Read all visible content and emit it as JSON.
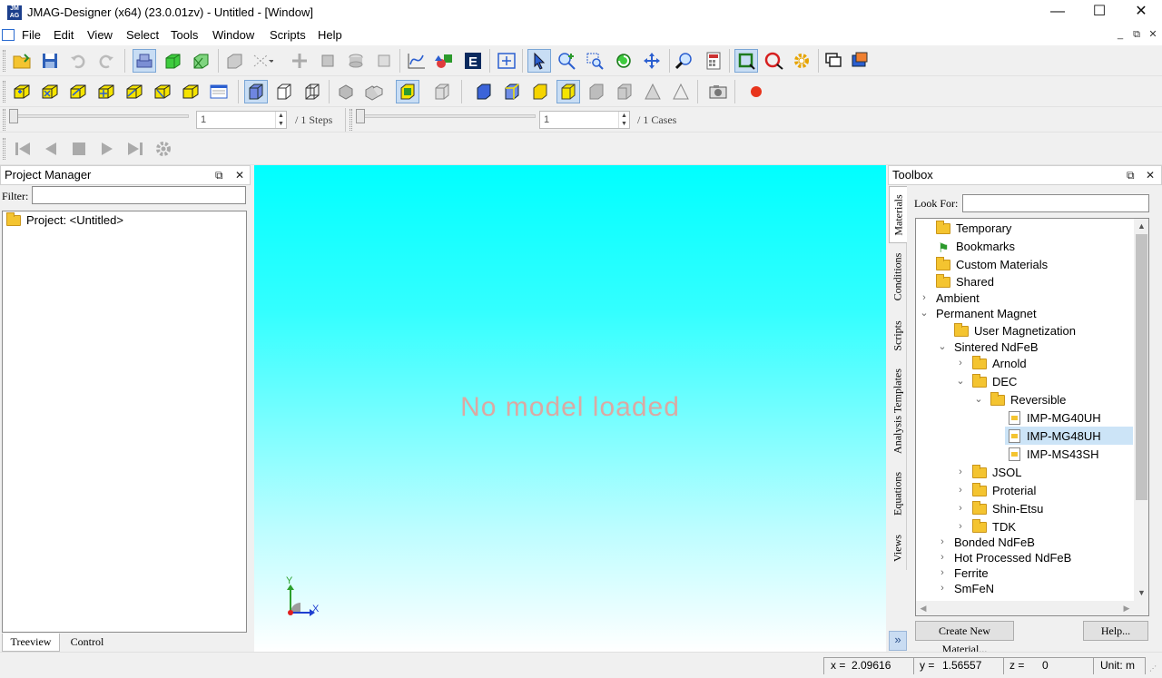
{
  "window": {
    "title": "JMAG-Designer (x64) (23.0.01zv) - Untitled - [Window]",
    "app_icon_text": "JM AG",
    "minimize": "—",
    "maximize": "☐",
    "close": "✕"
  },
  "menu": {
    "items": [
      "File",
      "Edit",
      "View",
      "Select",
      "Tools",
      "Window",
      "Scripts",
      "Help"
    ],
    "mdi_minimize": "_",
    "mdi_restore": "⧉",
    "mdi_close": "✕"
  },
  "animation": {
    "step_value": "1",
    "steps_label": "/ 1 Steps",
    "case_value": "1",
    "cases_label": "/ 1 Cases"
  },
  "project_manager": {
    "title": "Project Manager",
    "filter_label": "Filter:",
    "filter_value": "",
    "root_label": "Project: <Untitled>",
    "tabs": [
      "Treeview",
      "Control"
    ]
  },
  "viewport": {
    "message": "No model loaded",
    "axis_y": "Y",
    "axis_x": "X"
  },
  "toolbox": {
    "title": "Toolbox",
    "look_for_label": "Look For:",
    "look_for_value": "",
    "side_tabs": [
      "Materials",
      "Conditions",
      "Scripts",
      "Analysis Templates",
      "Equations",
      "Views"
    ],
    "tree": [
      {
        "label": "Temporary",
        "icon": "folder-doc-icon"
      },
      {
        "label": "Bookmarks",
        "icon": "bookmark-icon"
      },
      {
        "label": "Custom Materials",
        "icon": "folder-icon"
      },
      {
        "label": "Shared",
        "icon": "folder-icon"
      },
      {
        "label": "Ambient",
        "icon": "none"
      },
      {
        "label": "Permanent Magnet",
        "icon": "none"
      },
      {
        "label": "User Magnetization",
        "icon": "folder-icon"
      },
      {
        "label": "Sintered NdFeB",
        "icon": "none"
      },
      {
        "label": "Arnold",
        "icon": "folder-icon"
      },
      {
        "label": "DEC",
        "icon": "folder-icon"
      },
      {
        "label": "Reversible",
        "icon": "folder-icon"
      },
      {
        "label": "IMP-MG40UH",
        "icon": "material-icon"
      },
      {
        "label": "IMP-MG48UH",
        "icon": "material-icon"
      },
      {
        "label": "IMP-MS43SH",
        "icon": "material-icon"
      },
      {
        "label": "JSOL",
        "icon": "folder-icon"
      },
      {
        "label": "Proterial",
        "icon": "folder-icon"
      },
      {
        "label": "Shin-Etsu",
        "icon": "folder-icon"
      },
      {
        "label": "TDK",
        "icon": "folder-icon"
      },
      {
        "label": "Bonded NdFeB",
        "icon": "none"
      },
      {
        "label": "Hot Processed NdFeB",
        "icon": "none"
      },
      {
        "label": "Ferrite",
        "icon": "none"
      },
      {
        "label": "SmFeN",
        "icon": "none"
      }
    ],
    "create_button": "Create New Material...",
    "help_button": "Help...",
    "expand_icon": "»"
  },
  "status": {
    "x_label": "x =",
    "x_value": "2.09616",
    "y_label": "y =",
    "y_value": "1.56557",
    "z_label": "z =",
    "z_value": "0",
    "unit_label": "Unit: m"
  },
  "colors": {
    "viewport_top": "#00ffff",
    "viewport_bottom": "#ffffff",
    "selection": "#cce4f7",
    "folder": "#f4c430"
  }
}
